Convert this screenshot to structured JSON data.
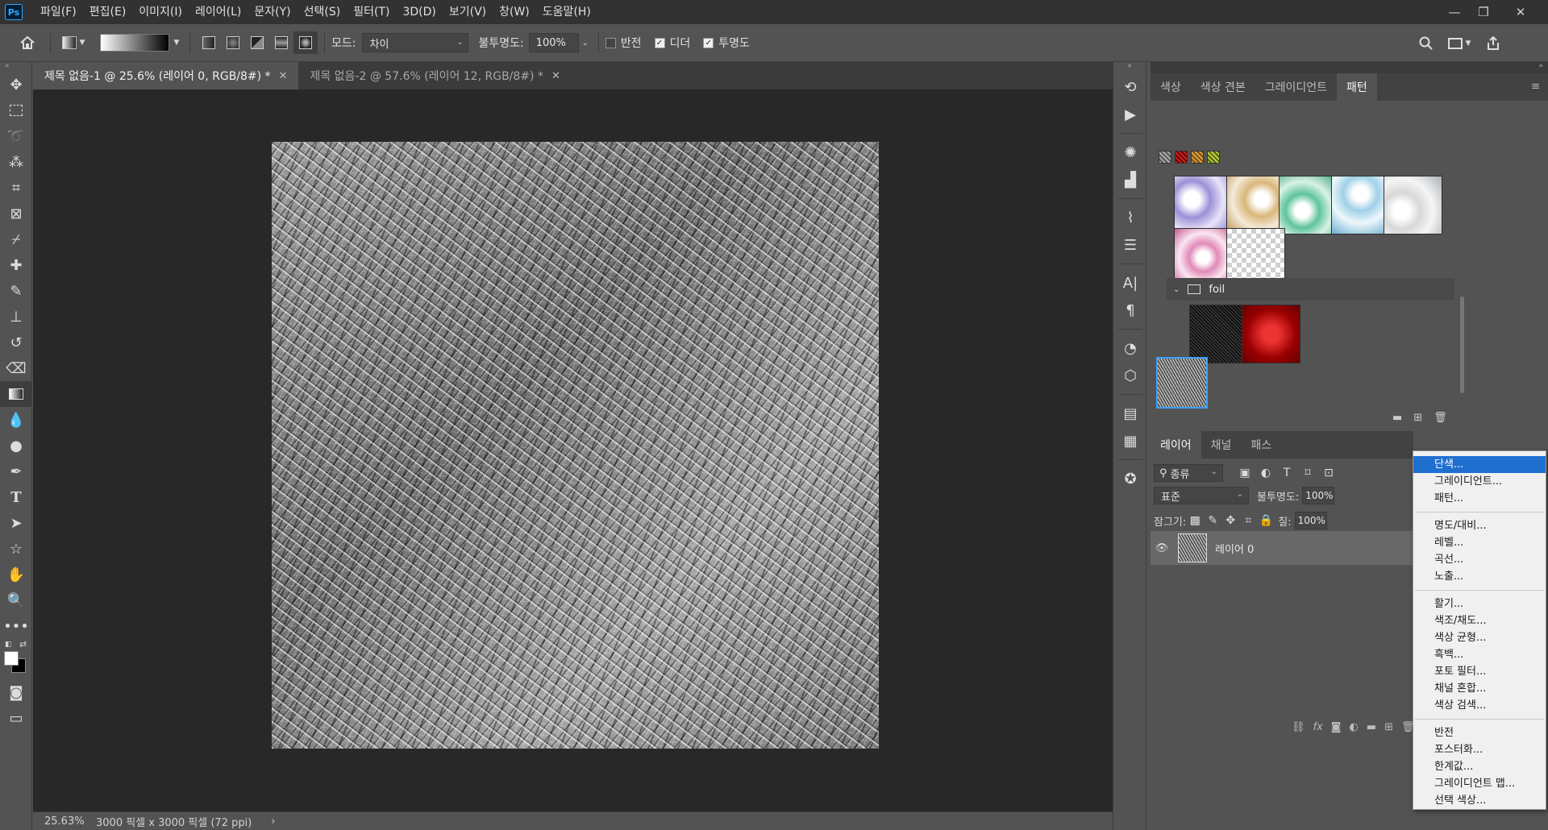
{
  "menubar": {
    "logo": "Ps",
    "items": [
      "파일(F)",
      "편집(E)",
      "이미지(I)",
      "레이어(L)",
      "문자(Y)",
      "선택(S)",
      "필터(T)",
      "3D(D)",
      "보기(V)",
      "창(W)",
      "도움말(H)"
    ]
  },
  "window_controls": {
    "minimize": "—",
    "restore": "❐",
    "close": "✕"
  },
  "options": {
    "mode_label": "모드:",
    "mode_value": "차이",
    "opacity_label": "불투명도:",
    "opacity_value": "100%",
    "reverse_label": "반전",
    "reverse_checked": false,
    "dither_label": "디더",
    "dither_checked": true,
    "transparency_label": "투명도",
    "transparency_checked": true
  },
  "tabs": [
    {
      "label": "제목 없음-1 @ 25.6% (레이어 0, RGB/8#) *",
      "active": true
    },
    {
      "label": "제목 없음-2 @ 57.6% (레이어 12, RGB/8#) *",
      "active": false
    }
  ],
  "status": {
    "zoom": "25.63%",
    "doc_size": "3000 픽셀 x 3000 픽셀 (72 ppi)",
    "arrow": "›"
  },
  "patterns_panel": {
    "tabs": [
      "색상",
      "색상 견본",
      "그레이디언트",
      "패턴"
    ],
    "active_tab": "패턴",
    "folder_name": "foil",
    "swatch_colors": [
      "#9c8fd8",
      "#d9b77a",
      "#5fc49b",
      "#9fd0e8",
      "#d8d8d8",
      "#e08ab8"
    ]
  },
  "layers_panel": {
    "tabs": [
      "레이어",
      "채널",
      "패스"
    ],
    "active_tab": "레이어",
    "filter_label": "종류",
    "blend_mode": "표준",
    "opacity_label": "불투명도:",
    "opacity_value": "100%",
    "lock_label": "잠그기:",
    "fill_label": "칠:",
    "fill_value": "100%",
    "layers": [
      {
        "name": "레이어 0",
        "visible": true
      }
    ],
    "fx_label": "fx"
  },
  "context_menu": {
    "groups": [
      [
        "단색...",
        "그레이디언트...",
        "패턴..."
      ],
      [
        "명도/대비...",
        "레벨...",
        "곡선...",
        "노출..."
      ],
      [
        "활기...",
        "색조/채도...",
        "색상 균형...",
        "흑백...",
        "포토 필터...",
        "채널 혼합...",
        "색상 검색..."
      ],
      [
        "반전",
        "포스터화...",
        "한계값...",
        "그레이디언트 맵...",
        "선택 색상..."
      ]
    ],
    "highlighted": "단색..."
  },
  "colors": {
    "accent": "#1f6fd1",
    "panel_bg": "#535353",
    "canvas_bg": "#282828",
    "selected_border": "#3aa0ff"
  }
}
